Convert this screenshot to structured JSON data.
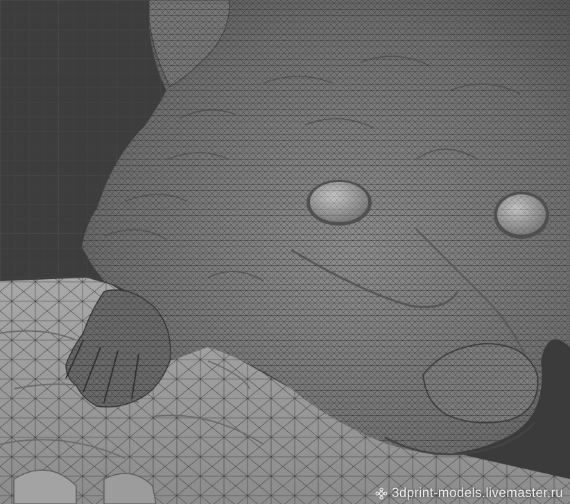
{
  "viewport": {
    "background_color": "#3d3d3d",
    "grid_color": "#474747",
    "mesh_color": "#8a8a8a",
    "wire_color": "#2a2a2a"
  },
  "watermark": {
    "icon": "gear-flower-icon",
    "text": "3dprint-models.livemaster.ru"
  }
}
